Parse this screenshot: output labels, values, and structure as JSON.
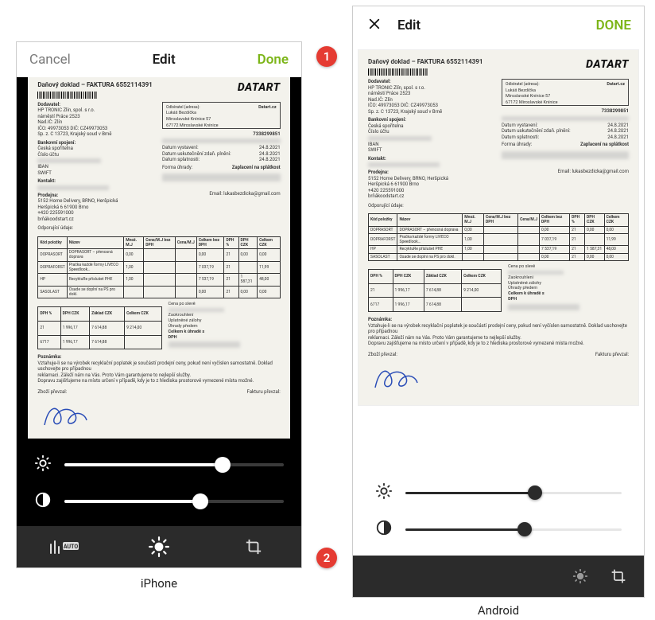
{
  "callouts": {
    "one": "1",
    "two": "2"
  },
  "captions": {
    "iphone": "iPhone",
    "android": "Android"
  },
  "iphone": {
    "header": {
      "cancel": "Cancel",
      "title": "Edit",
      "done": "Done"
    },
    "sliders": {
      "brightness": 72,
      "contrast": 62
    },
    "toolbar": {
      "levels_auto": "AUTO"
    }
  },
  "android": {
    "header": {
      "title": "Edit",
      "done": "DONE"
    },
    "sliders": {
      "brightness": 60,
      "contrast": 55
    }
  },
  "doc": {
    "logo": "DATART",
    "title": "Daňový doklad – FAKTURA 6552114391",
    "supplier_label": "Dodavatel:",
    "supplier_line1": "HP TRONIC Zlín, spol. s r.o.",
    "supplier_line2": "náměstí Práce 2523",
    "supplier_line3": "Nad.IČ: Zlín",
    "supplier_line4": "IČO: 49973053   DIČ: CZ49973053",
    "supplier_line5": "Sp. z. C 13723, Krajský soud v Brně",
    "domain": "Datart.cz",
    "recip_line1": "Lukáš Bezdíčka",
    "recip_line2": "Miroslavské Knínice 57",
    "recip_line3": "67172  Miroslavské Knínice",
    "bank_label": "Bankovní spojení:",
    "bank_line": "Česká spořitelna",
    "acct_label": "Číslo účtu",
    "iban_label": "IBAN",
    "swift_label": "SWIFT",
    "contact_label": "Kontakt:",
    "var_sym": "7338299851",
    "date1_label": "Datum vystavení:",
    "date1": "24.8.2021",
    "date2_label": "Datum uskutečnění zdaň. plnění:",
    "date2": "24.8.2021",
    "date3_label": "Datum splatnosti:",
    "date3": "24.8.2021",
    "pay_label": "Forma úhrady:",
    "pay_value": "Zaplacení na splátkost",
    "store_label": "Prodejna:",
    "store_line1": "5152 Home Delivery, BRNO, Heršpická",
    "store_line2": "Heršpická 6          61900  Brno",
    "store_line3": "+420 225591000",
    "store_line4": "brňákoodstart.cz",
    "buyer_label": "Odběratel (adresa):",
    "email_label": "Email: lukasbezdicka@gmail.com",
    "items_header_label": "Odporující údaje:",
    "th": {
      "code": "Kód položky",
      "name": "Název",
      "qty": "Množ. M.J",
      "unit_nodph": "Cena/M.J bez DPH",
      "unit_dph": "Cena/M.J",
      "sum_nodph": "Celkem bez DPH",
      "dph_pct": "DPH %",
      "dph": "DPH CZK",
      "sum": "Celkem CZK"
    },
    "rows": [
      {
        "code": "DOPRASORT",
        "name": "DOPRASORT – přenosná doprava",
        "unit": "0,00",
        "sum_nodph": "0,00",
        "dph_pct": "21",
        "dph": "0,00",
        "sum": "0,00"
      },
      {
        "code": "DOPRAFORST",
        "name": "Pračka každé formy LIVECO Speedlook…",
        "unit": "1,00",
        "sum_nodph": "7 037,19",
        "dph_pct": "21",
        "dph": "",
        "sum": "11,99"
      },
      {
        "code": "HP",
        "name": "RecyktuRe příslušet PHE",
        "unit": "1,00",
        "sum_nodph": "7 537,19",
        "dph_pct": "21",
        "dph": "1 587,31",
        "sum": "48,00"
      },
      {
        "code": "SASOLAST",
        "name": "Osade se doplní na PS pro dokl.",
        "unit": "",
        "sum_nodph": "0,00",
        "dph_pct": "21",
        "dph": "0,00",
        "sum": "0,00"
      }
    ],
    "summary_th": {
      "dph_pct": "DPH %",
      "dph": "DPH CZK",
      "base": "Základ CZK",
      "total": "Celkem CZK"
    },
    "summary_rows": [
      {
        "dph_pct": "21",
        "dph": "1 996,17",
        "base": "7 614,88",
        "total": "9 214,00"
      },
      {
        "dph_pct": "6717",
        "dph": "1 996,17",
        "base": "7 614,88",
        "total": ""
      }
    ],
    "right_lines": [
      "Cena po slevě",
      "Zaokrouhlení",
      "Uplatněné zálohy",
      "Úhrady předem",
      "Celkem k úhradě s",
      "DPH"
    ],
    "note_label": "Poznámka:",
    "note1": "Vztahuje-li se na výrobek recyklační poplatek je součástí prodejní ceny, pokud není vyčíslen samostatně. Doklad uschovejte pro případnou",
    "note2": "reklamaci. Záleží nám na Vás. Proto Vám garantujeme to nejlepší služby.",
    "note3": "Dopravu zajišťujeme na místo určení v případě, kdy je to z hlediska prostorové vymezené místa možné.",
    "sig_left": "Zboží převzal:",
    "sig_right": "Fakturu převzal:"
  }
}
